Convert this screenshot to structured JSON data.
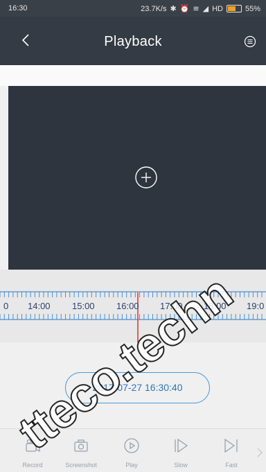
{
  "status_bar": {
    "time": "16:30",
    "network_speed": "23.7K/s",
    "network": "HD",
    "battery": "55%"
  },
  "header": {
    "title": "Playback",
    "back_icon": "chevron-left-icon",
    "menu_icon": "menu-icon"
  },
  "player": {
    "add_icon": "plus-circle-icon"
  },
  "timeline": {
    "labels": [
      "0",
      "14:00",
      "15:00",
      "16:00",
      "17:00",
      "18:00",
      "19:0"
    ],
    "cursor_color": "#e53935"
  },
  "date_time": "2017-07-27 16:30:40",
  "toolbar": {
    "items": [
      {
        "label": "Record",
        "icon": "camera-video-icon"
      },
      {
        "label": "Screenshot",
        "icon": "camera-icon"
      },
      {
        "label": "Play",
        "icon": "play-circle-icon"
      },
      {
        "label": "Slow",
        "icon": "slow-icon"
      },
      {
        "label": "Fast",
        "icon": "fast-icon"
      }
    ],
    "more_icon": "chevron-right-icon"
  },
  "watermark": "tteco.techn"
}
